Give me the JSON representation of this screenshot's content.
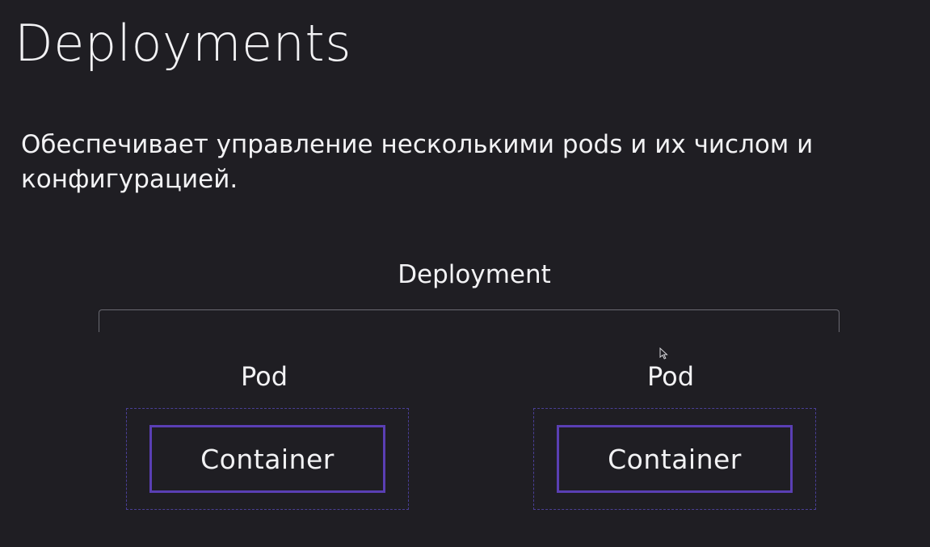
{
  "slide": {
    "title": "Deployments",
    "description": "Обеспечивает управление несколькими pods и их числом и конфигурацией.",
    "diagram": {
      "deployment_label": "Deployment",
      "pods": [
        {
          "label": "Pod",
          "container_label": "Container"
        },
        {
          "label": "Pod",
          "container_label": "Container"
        }
      ]
    }
  },
  "colors": {
    "background": "#1f1e23",
    "text": "#f2f2f4",
    "container_border": "#5a3fb4",
    "pod_border_dashed": "#4a3f96",
    "bracket": "#6a6a72"
  },
  "icons": {
    "cursor": "mouse-pointer-icon"
  }
}
